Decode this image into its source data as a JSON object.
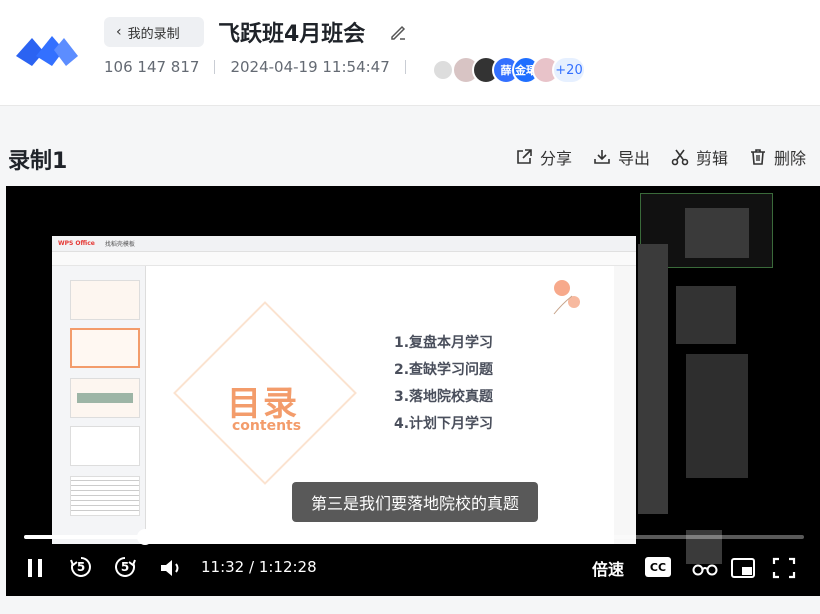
{
  "header": {
    "back_label": "我的录制",
    "title": "飞跃班4月班会",
    "meeting_id": "106 147 817",
    "datetime": "2024-04-19 11:54:47",
    "avatars": [
      {
        "text": "",
        "color": "#d8c4c4"
      },
      {
        "text": "",
        "color": "#333333"
      },
      {
        "text": "薛",
        "color": "#3370ff"
      },
      {
        "text": "金珺",
        "color": "#1f6fff"
      },
      {
        "text": "",
        "color": "#e8c3c9"
      }
    ],
    "more_count": "+20"
  },
  "recording": {
    "title": "录制1",
    "actions": [
      {
        "icon": "share-icon",
        "label": "分享"
      },
      {
        "icon": "export-icon",
        "label": "导出"
      },
      {
        "icon": "scissors-icon",
        "label": "剪辑"
      },
      {
        "icon": "trash-icon",
        "label": "删除"
      }
    ]
  },
  "slide": {
    "heading": "目录",
    "heading_en": "contents",
    "items": [
      "1.复盘本月学习",
      "2.查缺学习问题",
      "3.落地院校真题",
      "4.计划下月学习"
    ],
    "app_name": "WPS Office",
    "tab2": "找稻壳模板"
  },
  "player": {
    "subtitle": "第三是我们要落地院校的真题",
    "progress_fraction": 0.155,
    "time_display": "11:32 / 1:12:28",
    "speed_label": "倍速",
    "skip_back": "5",
    "skip_forward": "5",
    "accent": "#3370ff"
  }
}
